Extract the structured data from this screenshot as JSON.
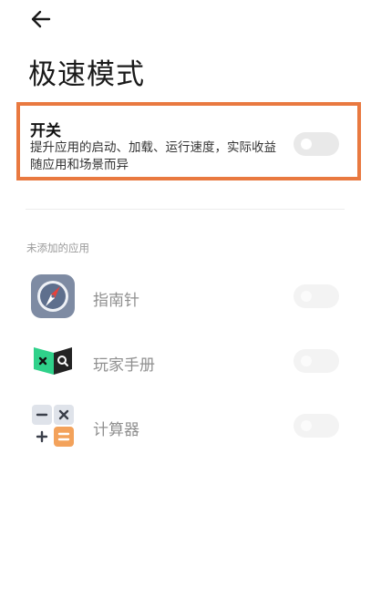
{
  "header": {
    "back_icon": "arrow-left-icon",
    "title": "极速模式"
  },
  "main_toggle": {
    "title": "开关",
    "description": "提升应用的启动、加载、运行速度，实际收益随应用和场景而异",
    "state": "off",
    "highlight_color": "#e97940"
  },
  "section": {
    "label": "未添加的应用"
  },
  "apps": [
    {
      "name": "指南针",
      "icon": "compass-app-icon",
      "state": "off"
    },
    {
      "name": "玩家手册",
      "icon": "game-handbook-app-icon",
      "state": "off"
    },
    {
      "name": "计算器",
      "icon": "calculator-app-icon",
      "state": "off"
    }
  ]
}
